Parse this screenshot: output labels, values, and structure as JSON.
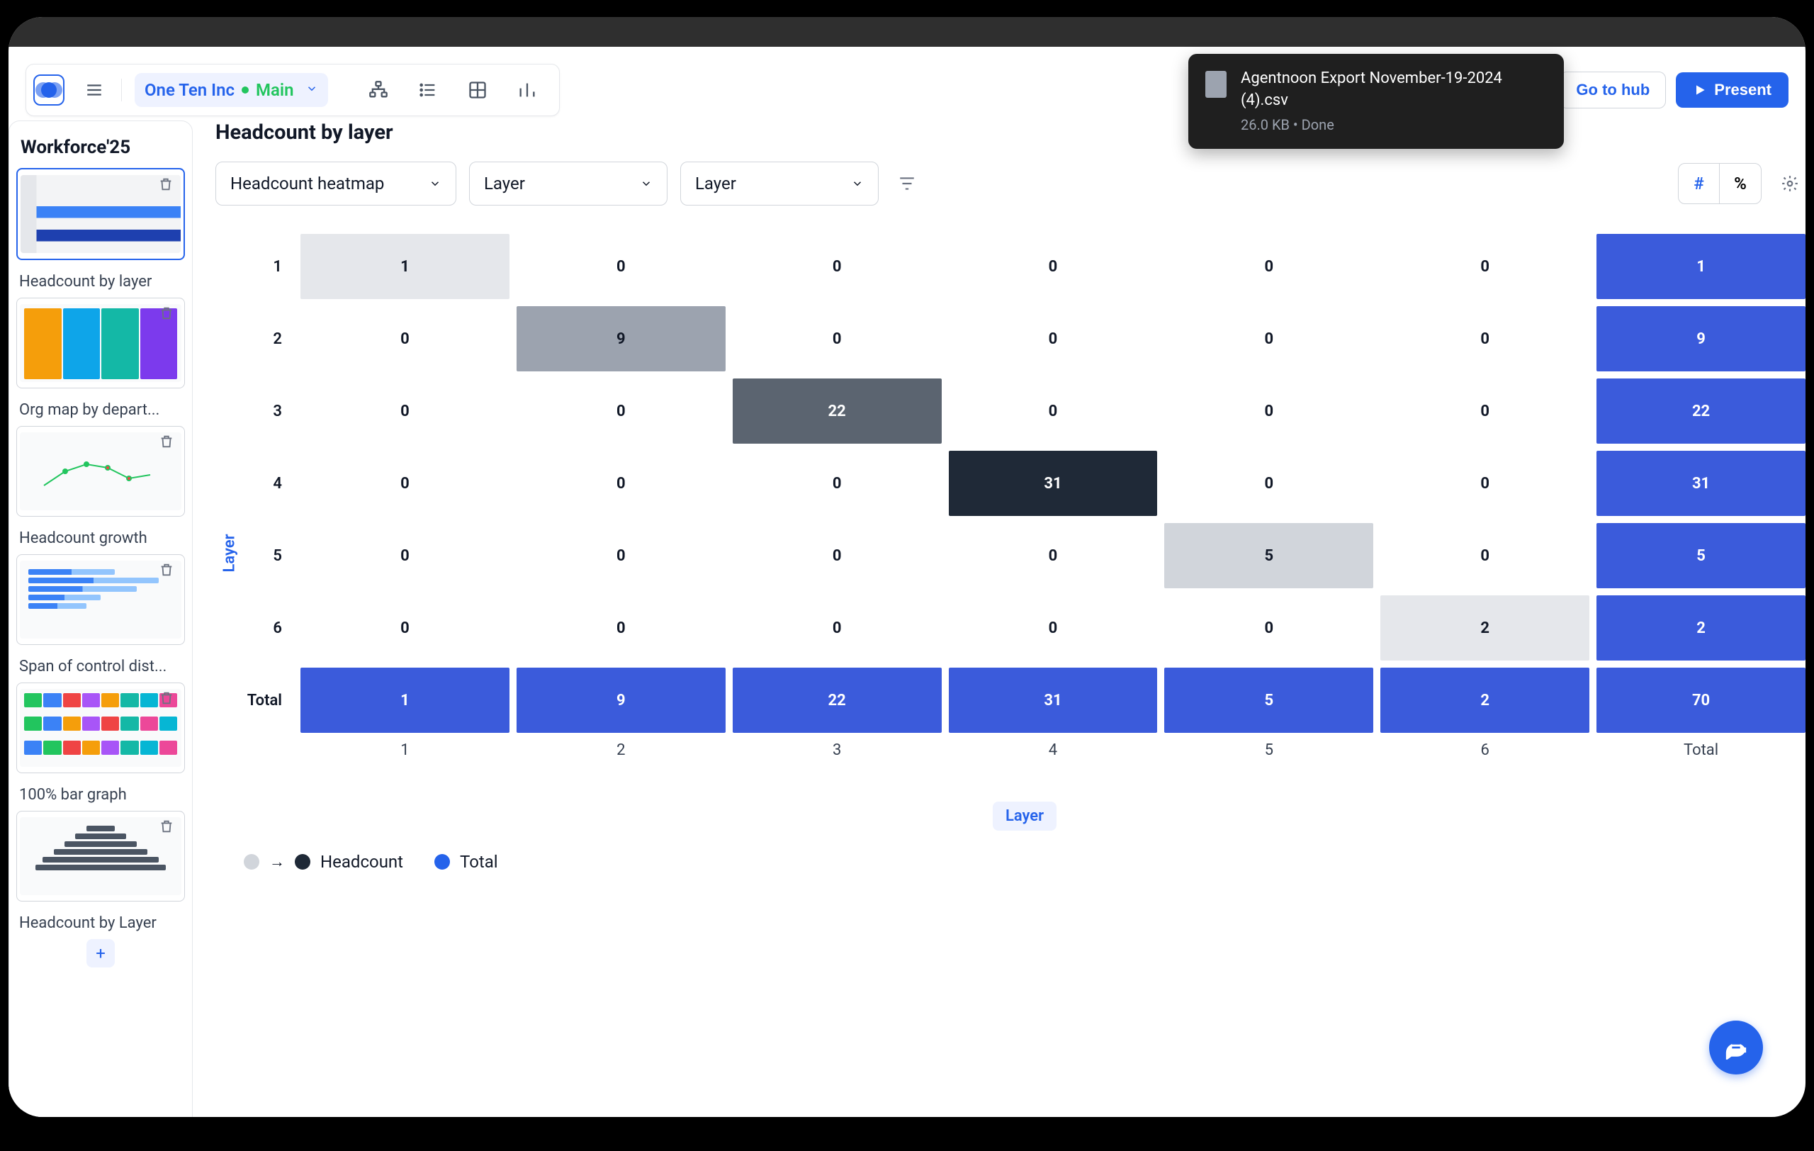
{
  "toolbar": {
    "org_name": "One Ten Inc",
    "branch": "Main",
    "hub_label": "Go to hub",
    "present_label": "Present"
  },
  "toast": {
    "title": "Agentnoon Export",
    "filename": "November-19-2024 (4).csv",
    "size": "26.0 KB",
    "status": "Done"
  },
  "sidebar": {
    "title": "Workforce'25",
    "items": [
      {
        "label": "Headcount by layer"
      },
      {
        "label": "Org map by depart..."
      },
      {
        "label": "Headcount growth"
      },
      {
        "label": "Span of control dist..."
      },
      {
        "label": "100% bar graph"
      },
      {
        "label": "Headcount by Layer"
      }
    ]
  },
  "main": {
    "title": "Headcount by layer",
    "dropdown1": "Headcount heatmap",
    "dropdown2": "Layer",
    "dropdown3": "Layer",
    "toggle_hash": "#",
    "toggle_pct": "%",
    "y_axis_label": "Layer",
    "x_axis_caption": "Layer",
    "legend_headcount": "Headcount",
    "legend_total": "Total"
  },
  "chart_data": {
    "type": "heatmap",
    "title": "Headcount by layer",
    "xlabel": "Layer",
    "ylabel": "Layer",
    "row_labels": [
      "1",
      "2",
      "3",
      "4",
      "5",
      "6",
      "Total"
    ],
    "col_labels": [
      "1",
      "2",
      "3",
      "4",
      "5",
      "6",
      "Total"
    ],
    "matrix": [
      [
        1,
        0,
        0,
        0,
        0,
        0,
        1
      ],
      [
        0,
        9,
        0,
        0,
        0,
        0,
        9
      ],
      [
        0,
        0,
        22,
        0,
        0,
        0,
        22
      ],
      [
        0,
        0,
        0,
        31,
        0,
        0,
        31
      ],
      [
        0,
        0,
        0,
        0,
        5,
        0,
        5
      ],
      [
        0,
        0,
        0,
        0,
        0,
        2,
        2
      ],
      [
        1,
        9,
        22,
        31,
        5,
        2,
        70
      ]
    ],
    "heat_class": [
      [
        "h0",
        "zero",
        "zero",
        "zero",
        "zero",
        "zero",
        "total"
      ],
      [
        "zero",
        "h1",
        "zero",
        "zero",
        "zero",
        "zero",
        "total"
      ],
      [
        "zero",
        "zero",
        "h2",
        "zero",
        "zero",
        "zero",
        "total"
      ],
      [
        "zero",
        "zero",
        "zero",
        "h3",
        "zero",
        "zero",
        "total"
      ],
      [
        "zero",
        "zero",
        "zero",
        "zero",
        "h4",
        "zero",
        "total"
      ],
      [
        "zero",
        "zero",
        "zero",
        "zero",
        "zero",
        "h5",
        "total"
      ],
      [
        "total",
        "total",
        "total",
        "total",
        "total",
        "total",
        "total"
      ]
    ]
  }
}
